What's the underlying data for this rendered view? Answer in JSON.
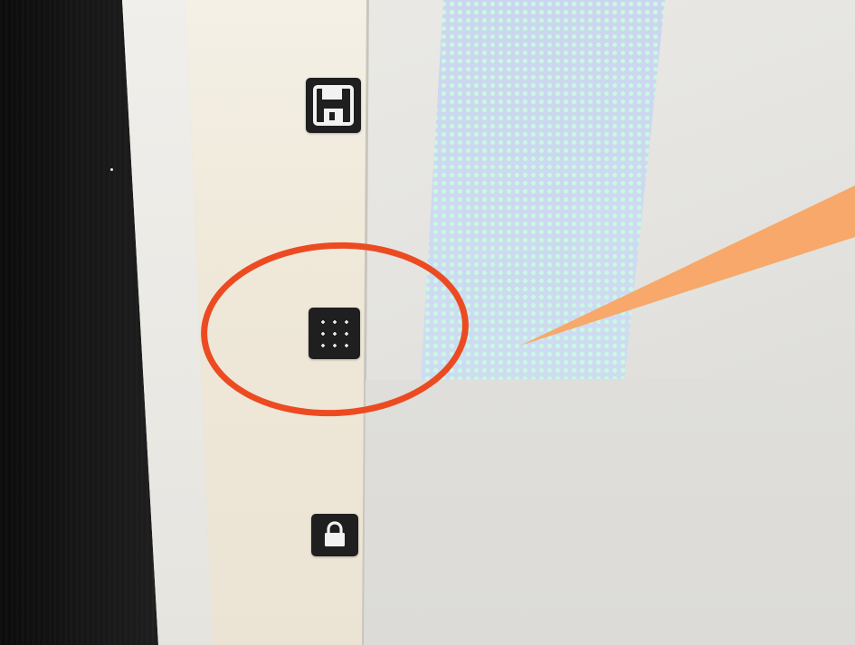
{
  "toolbar": {
    "tools": [
      {
        "id": "save",
        "icon": "floppy-disk-icon",
        "color": "#1f1f20"
      },
      {
        "id": "grid",
        "icon": "grid-plus-icon",
        "color": "#1f1f20",
        "highlighted": true
      },
      {
        "id": "lock",
        "icon": "lock-icon",
        "color": "#1f1f20"
      }
    ]
  },
  "annotation": {
    "highlight_color": "#ec4b22",
    "callout_color": "#f7a86a"
  },
  "canvas": {
    "selection_color": "#c9d4f0"
  }
}
